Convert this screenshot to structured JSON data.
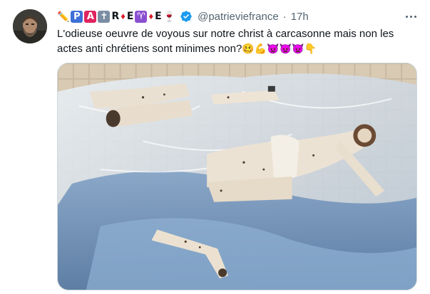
{
  "tweet": {
    "display_name_glyphs": [
      {
        "kind": "glyph",
        "icon": "pencil-emoji",
        "char": "✏️"
      },
      {
        "kind": "tile",
        "color": "blue",
        "char": "P"
      },
      {
        "kind": "tile",
        "color": "red",
        "char": "A"
      },
      {
        "kind": "tile",
        "color": "grey",
        "char": "✝"
      },
      {
        "kind": "letter",
        "char": "R"
      },
      {
        "kind": "drop",
        "icon": "blood-drop-emoji",
        "char": "♦"
      },
      {
        "kind": "letter",
        "char": "E"
      },
      {
        "kind": "tile",
        "color": "purple",
        "char": "♈"
      },
      {
        "kind": "drop",
        "icon": "blood-drop-emoji",
        "char": "♦"
      },
      {
        "kind": "letter",
        "char": "E"
      },
      {
        "kind": "glyph",
        "icon": "wine-glass-emoji",
        "char": "🍷"
      }
    ],
    "handle": "@patrieviefrance",
    "separator": "·",
    "time": "17h",
    "text": "L'odieuse oeuvre de voyous sur notre christ à carcasonne mais non les actes anti chrétiens sont minimes non?",
    "text_emojis": "🥴💪👿👿👿👇",
    "colors": {
      "verified": "#1d9bf0",
      "secondary_text": "#536471",
      "border": "#cfd9de"
    }
  }
}
